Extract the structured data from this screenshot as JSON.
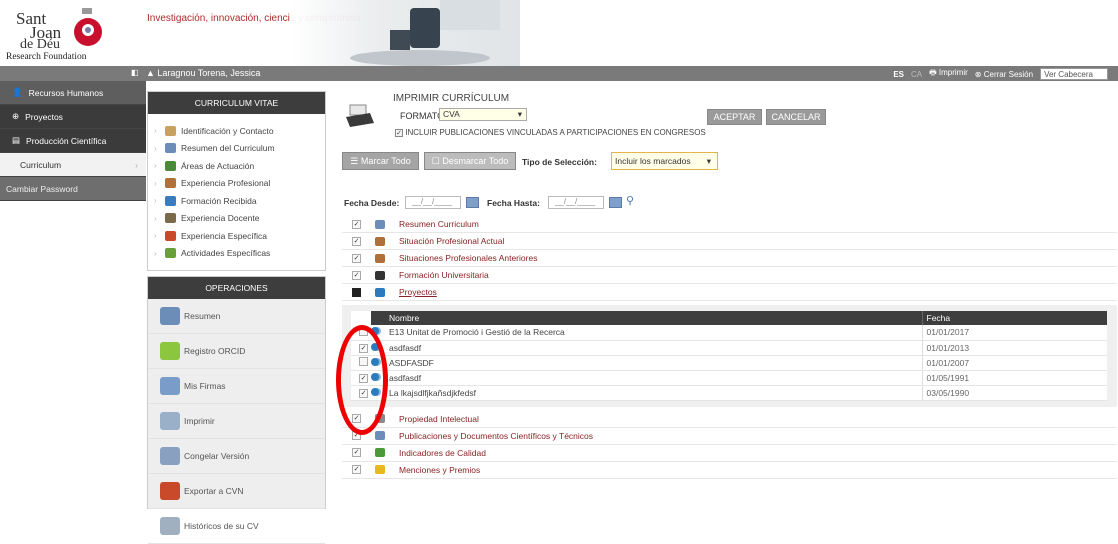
{
  "header": {
    "logo_line1": "Sant",
    "logo_line2": "Joan",
    "logo_line3": "de Déu",
    "logo_subtitle": "Research Foundation",
    "tagline": "Investigación, innovación, ciencia y compromiso"
  },
  "topbar": {
    "user_name": "Laragnou Torena, Jessica",
    "lang": "ES",
    "lang_alt": "CA",
    "print": "Imprimir",
    "logout": "Cerrar Sesión",
    "view_header": "Ver Cabecera"
  },
  "sidebar": {
    "items": [
      {
        "label": "Recursos Humanos"
      },
      {
        "label": "Proyectos"
      },
      {
        "label": "Producción Científica"
      },
      {
        "label": "Curriculum"
      },
      {
        "label": "Cambiar Password"
      }
    ]
  },
  "cv_panel": {
    "title": "CURRICULUM VITAE",
    "items": [
      {
        "label": "Identificación y Contacto",
        "color": "#c8a060"
      },
      {
        "label": "Resumen del Curriculum",
        "color": "#6b8db8"
      },
      {
        "label": "Áreas de Actuación",
        "color": "#4a8a3a"
      },
      {
        "label": "Experiencia Profesional",
        "color": "#b0703a"
      },
      {
        "label": "Formación Recibida",
        "color": "#3a7abf"
      },
      {
        "label": "Experiencia Docente",
        "color": "#7a6a4a"
      },
      {
        "label": "Experiencia Específica",
        "color": "#c84a2a"
      },
      {
        "label": "Actividades Específicas",
        "color": "#6aa03a"
      }
    ]
  },
  "ops_panel": {
    "title": "OPERACIONES",
    "items": [
      {
        "label": "Resumen",
        "color": "#6b8db8"
      },
      {
        "label": "Registro ORCID",
        "color": "#8cc63f"
      },
      {
        "label": "Mis Firmas",
        "color": "#7a9cc8"
      },
      {
        "label": "Imprimir",
        "color": "#9ab0c8"
      },
      {
        "label": "Congelar Versión",
        "color": "#8aa0c0"
      },
      {
        "label": "Exportar a CVN",
        "color": "#c84a2a"
      },
      {
        "label": "Históricos de su CV",
        "color": "#a0b0c0"
      }
    ]
  },
  "print_form": {
    "title": "IMPRIMIR CURRÍCULUM",
    "format_label": "FORMATO:",
    "format_value": "CVA",
    "include_label": "INCLUIR PUBLICACIONES VINCULADAS A PARTICIPACIONES EN CONGRESOS",
    "accept": "ACEPTAR",
    "cancel": "CANCELAR",
    "mark_all": "Marcar Todo",
    "unmark_all": "Desmarcar Todo",
    "selection_type_label": "Tipo de Selección:",
    "selection_type_value": "Incluir los marcados",
    "date_from_label": "Fecha Desde:",
    "date_to_label": "Fecha Hasta:",
    "date_placeholder": "__/__/____"
  },
  "sections_top": [
    {
      "label": "Resumen Curriculum",
      "checked": "✓",
      "color": "#6b8db8"
    },
    {
      "label": "Situación Profesional Actual",
      "checked": "✓",
      "color": "#b0703a"
    },
    {
      "label": "Situaciones Profesionales Anteriores",
      "checked": "✓",
      "color": "#b0703a"
    },
    {
      "label": "Formación Universitaria",
      "checked": "✓",
      "color": "#333333"
    },
    {
      "label": "Proyectos",
      "checked": "",
      "color": "#2b7bbf"
    }
  ],
  "projects_table": {
    "col_name": "Nombre",
    "col_date": "Fecha",
    "rows": [
      {
        "checked": "",
        "name": "E13 Unitat de Promoció i Gestió de la Recerca",
        "date": "01/01/2017"
      },
      {
        "checked": "✓",
        "name": "asdfasdf",
        "date": "01/01/2013"
      },
      {
        "checked": "",
        "name": "ASDFASDF",
        "date": "01/01/2007"
      },
      {
        "checked": "✓",
        "name": "asdfasdf",
        "date": "01/05/1991"
      },
      {
        "checked": "✓",
        "name": "La lkajsdlfjkañsdjkfedsf",
        "date": "03/05/1990"
      }
    ]
  },
  "sections_bottom": [
    {
      "label": "Propiedad Intelectual",
      "checked": "✓",
      "color": "#8a8a8a"
    },
    {
      "label": "Publicaciones y Documentos Científicos y Técnicos",
      "checked": "✓",
      "color": "#6b8db8"
    },
    {
      "label": "Indicadores de Calidad",
      "checked": "✓",
      "color": "#4a9a3a"
    },
    {
      "label": "Menciones y Premios",
      "checked": "✓",
      "color": "#e8b820"
    }
  ]
}
